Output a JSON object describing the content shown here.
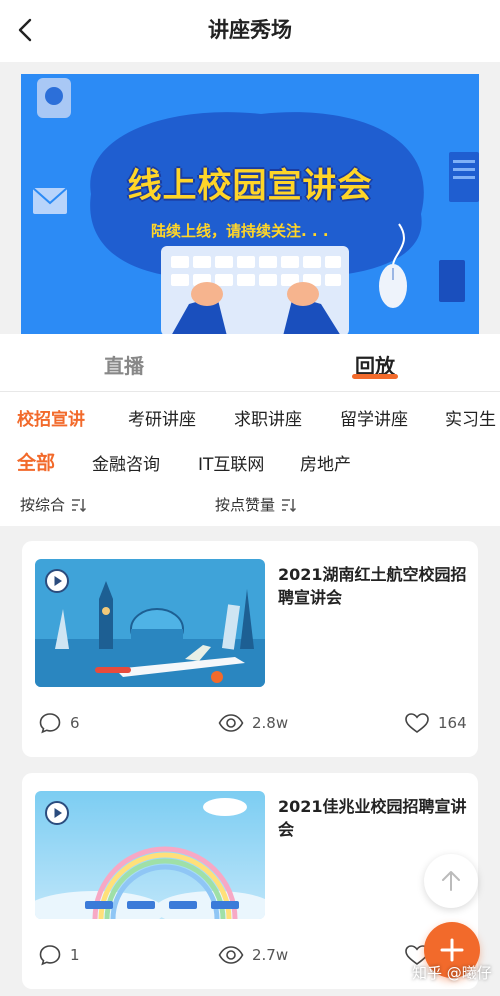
{
  "header": {
    "title": "讲座秀场"
  },
  "banner": {
    "title": "线上校园宣讲会",
    "subtitle": "陆续上线，请持续关注. . ."
  },
  "mode_tabs": {
    "live": "直播",
    "replay": "回放"
  },
  "categories": [
    "校招宣讲",
    "考研讲座",
    "求职讲座",
    "留学讲座",
    "实习生"
  ],
  "subcategories": [
    "全部",
    "金融咨询",
    "IT互联网",
    "房地产"
  ],
  "sort": {
    "overall": "按综合",
    "likes": "按点赞量"
  },
  "cards": [
    {
      "title": "2021湖南红土航空校园招聘宣讲会",
      "comments": "6",
      "views": "2.8w",
      "likes": "164"
    },
    {
      "title": "2021佳兆业校园招聘宣讲会",
      "comments": "1",
      "views": "2.7w",
      "likes": ""
    }
  ],
  "watermark": "知乎 @曦仔",
  "colors": {
    "accent": "#f26a2b",
    "banner_blue": "#2c8bf5",
    "banner_yellow": "#ffd528"
  }
}
